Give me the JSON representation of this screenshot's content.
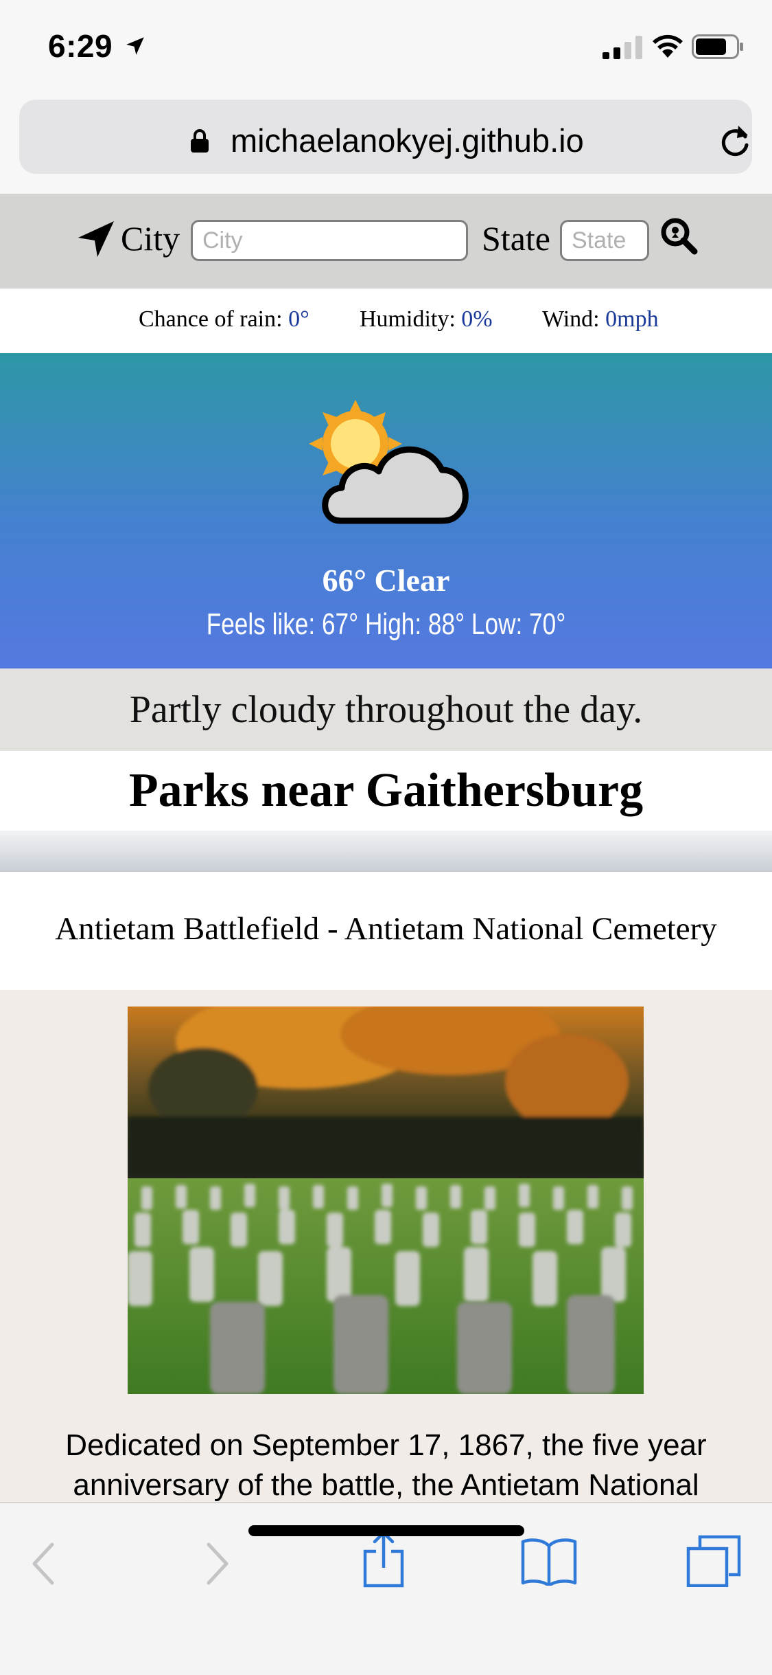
{
  "status_bar": {
    "time": "6:29",
    "icons": [
      "location-arrow-icon",
      "signal-icon",
      "wifi-icon",
      "battery-icon"
    ]
  },
  "browser": {
    "url": "michaelanokyej.github.io",
    "icons": [
      "lock-icon",
      "reload-icon"
    ]
  },
  "search": {
    "city_label": "City",
    "city_placeholder": "City",
    "city_value": "",
    "state_label": "State",
    "state_placeholder": "State",
    "state_value": "",
    "icons": [
      "navigation-arrow-icon",
      "search-icon"
    ]
  },
  "stats": {
    "rain_label": "Chance of rain:",
    "rain_value": "0°",
    "humidity_label": "Humidity:",
    "humidity_value": "0%",
    "wind_label": "Wind:",
    "wind_value": "0mph"
  },
  "weather": {
    "icon": "partly-cloudy-icon",
    "temp_condition": "66° Clear",
    "feels_line": "Feels like: 67°  High: 88°  Low: 70°"
  },
  "summary": "Partly cloudy throughout the day.",
  "parks_heading": "Parks near Gaithersburg",
  "park": {
    "title": "Antietam Battlefield - Antietam National Cemetery",
    "image": "cemetery-photo",
    "description": "Dedicated on September 17, 1867, the five year anniversary of the battle, the Antietam National"
  },
  "toolbar": {
    "icons": [
      "back-icon",
      "forward-icon",
      "share-icon",
      "bookmarks-icon",
      "tabs-icon"
    ]
  },
  "colors": {
    "accent_value": "#1a3a9a",
    "weather_gradient_top": "#2e97a6",
    "weather_gradient_bottom": "#5579e0",
    "safari_blue": "#2f7ad8"
  }
}
